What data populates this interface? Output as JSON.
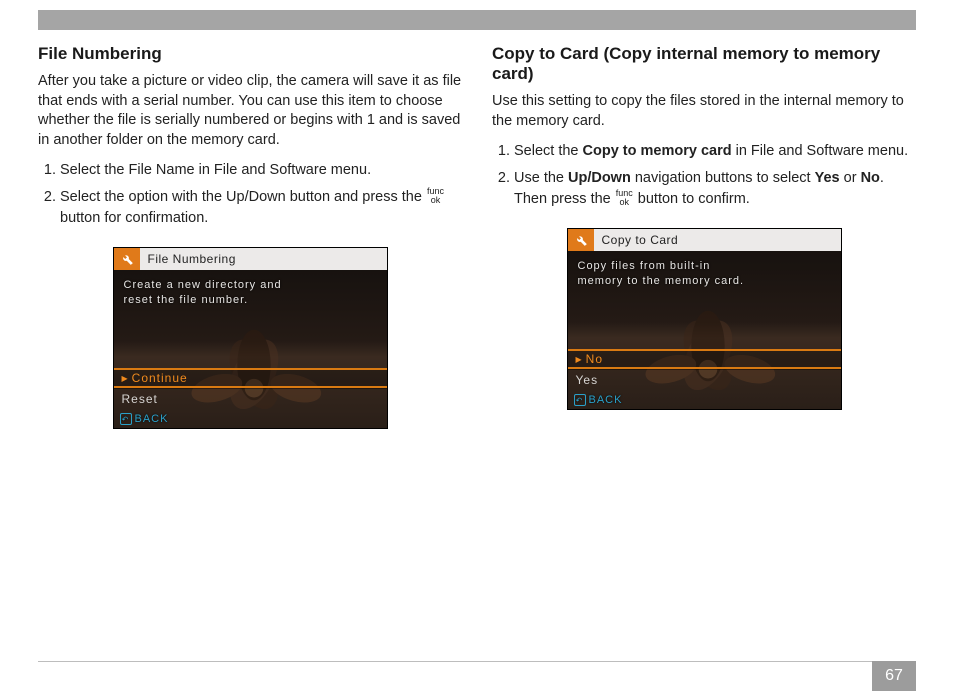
{
  "page_number": "67",
  "left": {
    "heading": "File Numbering",
    "intro": "After you take a picture or video clip, the camera will save it as file that ends with a serial number. You can use this item to choose whether the file is serially numbered or begins with 1 and is saved in another folder on the memory card.",
    "step1": "Select the File Name in File and Software menu.",
    "step2_a": "Select the option with the Up/Down button and press the ",
    "step2_b": " button for confirmation.",
    "cam": {
      "title": "File Numbering",
      "desc_l1": "Create a new directory and",
      "desc_l2": "reset the file number.",
      "opt_sel": "Continue",
      "opt2": "Reset",
      "back": "BACK"
    }
  },
  "right": {
    "heading": "Copy to Card (Copy internal memory to memory card)",
    "intro": "Use this setting to copy the files stored in the internal memory to the memory card.",
    "step1_a": "Select the ",
    "step1_bold": "Copy to memory card",
    "step1_b": " in File and Software menu.",
    "step2_a": "Use the ",
    "step2_bold1": "Up/Down",
    "step2_b": " navigation buttons to select ",
    "step2_bold2": "Yes",
    "step2_c": " or ",
    "step2_bold3": "No",
    "step2_d": ". Then press the ",
    "step2_e": " button to confirm.",
    "cam": {
      "title": "Copy to Card",
      "desc_l1": "Copy files from built-in",
      "desc_l2": "memory to the memory card.",
      "opt_sel": "No",
      "opt2": "Yes",
      "back": "BACK"
    }
  },
  "func": {
    "top": "func",
    "bot": "ok"
  }
}
